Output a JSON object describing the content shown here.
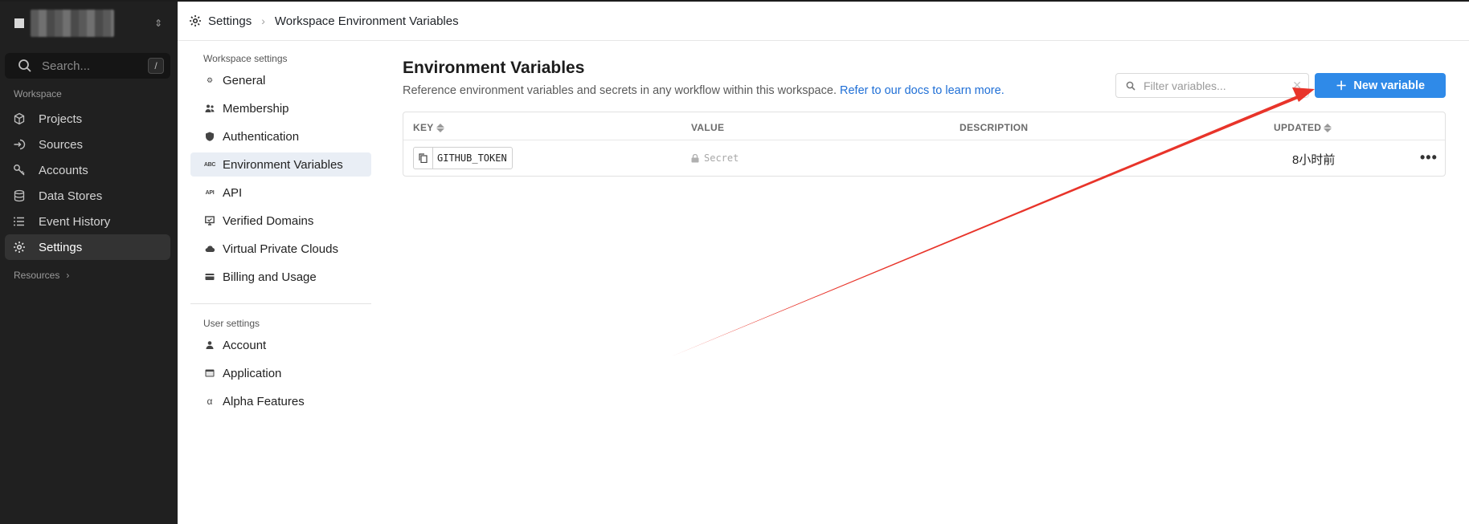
{
  "colors": {
    "sidebar_bg": "#202020",
    "accent": "#2f8ae8",
    "link": "#1f6fd6",
    "annotation_arrow": "#e8342a"
  },
  "sidebar": {
    "workspace_chevron": "⌃⌄",
    "search": {
      "placeholder": "Search...",
      "shortcut": "/"
    },
    "section_label": "Workspace",
    "items": [
      {
        "label": "Projects",
        "icon": "cube-icon",
        "active": false
      },
      {
        "label": "Sources",
        "icon": "sign-in-icon",
        "active": false
      },
      {
        "label": "Accounts",
        "icon": "key-icon",
        "active": false
      },
      {
        "label": "Data Stores",
        "icon": "database-icon",
        "active": false
      },
      {
        "label": "Event History",
        "icon": "list-icon",
        "active": false
      },
      {
        "label": "Settings",
        "icon": "gear-icon",
        "active": true
      }
    ],
    "resources_label": "Resources"
  },
  "header": {
    "breadcrumb": [
      "Settings",
      "Workspace Environment Variables"
    ]
  },
  "settings_nav": {
    "workspace_label": "Workspace settings",
    "workspace_items": [
      {
        "label": "General",
        "icon": "gear-icon",
        "active": false
      },
      {
        "label": "Membership",
        "icon": "people-icon",
        "active": false
      },
      {
        "label": "Authentication",
        "icon": "shield-icon",
        "active": false
      },
      {
        "label": "Environment Variables",
        "icon": "abc-icon",
        "active": true
      },
      {
        "label": "API",
        "icon": "api-icon",
        "active": false
      },
      {
        "label": "Verified Domains",
        "icon": "domain-icon",
        "active": false
      },
      {
        "label": "Virtual Private Clouds",
        "icon": "cloud-icon",
        "active": false
      },
      {
        "label": "Billing and Usage",
        "icon": "card-icon",
        "active": false
      }
    ],
    "user_label": "User settings",
    "user_items": [
      {
        "label": "Account",
        "icon": "person-icon",
        "active": false
      },
      {
        "label": "Application",
        "icon": "window-icon",
        "active": false
      },
      {
        "label": "Alpha Features",
        "icon": "alpha-icon",
        "active": false
      }
    ]
  },
  "main": {
    "title": "Environment Variables",
    "subtitle": "Reference environment variables and secrets in any workflow within this workspace.",
    "docs_link": "Refer to our docs to learn more.",
    "filter_placeholder": "Filter variables...",
    "new_button": "New variable",
    "table": {
      "columns": [
        "KEY",
        "VALUE",
        "DESCRIPTION",
        "UPDATED"
      ],
      "rows": [
        {
          "key": "GITHUB_TOKEN",
          "value": "Secret",
          "description": "",
          "updated": "8小时前"
        }
      ]
    }
  }
}
